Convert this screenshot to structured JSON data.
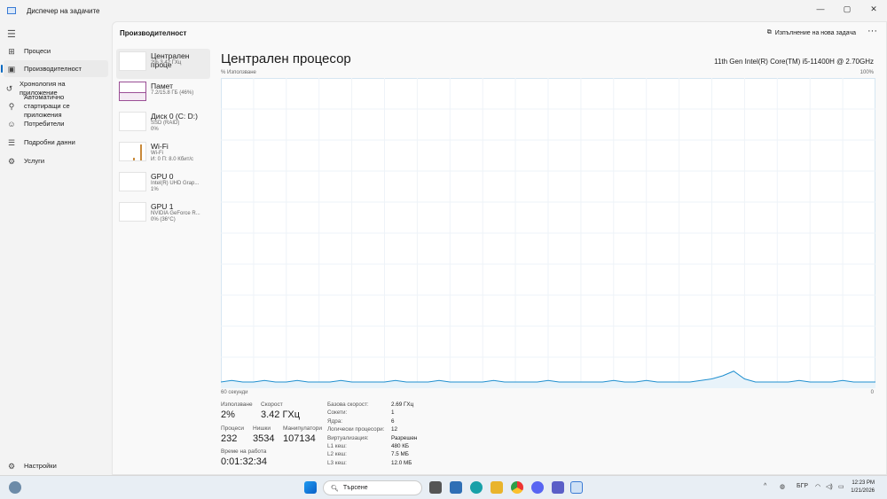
{
  "window": {
    "title": "Диспечер на задачите",
    "min": "—",
    "max": "▢",
    "close": "✕"
  },
  "nav": {
    "items": [
      {
        "label": "Процеси",
        "icon": "processes-icon",
        "glyph": "⊞"
      },
      {
        "label": "Производителност",
        "icon": "performance-icon",
        "glyph": "▣"
      },
      {
        "label": "Хронология на приложение",
        "icon": "history-icon",
        "glyph": "↺"
      },
      {
        "label": "Автоматично стартиращи се приложения",
        "icon": "startup-icon",
        "glyph": "⚲"
      },
      {
        "label": "Потребители",
        "icon": "users-icon",
        "glyph": "☺"
      },
      {
        "label": "Подробни данни",
        "icon": "details-icon",
        "glyph": "☰"
      },
      {
        "label": "Услуги",
        "icon": "services-icon",
        "glyph": "⚙"
      }
    ],
    "settings": "Настройки"
  },
  "header": {
    "title": "Производителност",
    "new_task": "Изпълнение на нова задача",
    "more": "···"
  },
  "devices": [
    {
      "name": "Централен проце",
      "s1": "2% 3.42 ГХц",
      "s2": ""
    },
    {
      "name": "Памет",
      "s1": "7.2/15.8 ГБ (46%)",
      "s2": ""
    },
    {
      "name": "Диск 0 (C: D:)",
      "s1": "SSD (RAID)",
      "s2": "0%"
    },
    {
      "name": "Wi-Fi",
      "s1": "Wi-Fi",
      "s2": "И: 0 П: 8.0 Кбит/с"
    },
    {
      "name": "GPU 0",
      "s1": "Intel(R) UHD Grap...",
      "s2": "1%"
    },
    {
      "name": "GPU 1",
      "s1": "NVIDIA GeForce R...",
      "s2": "0% (36°C)"
    }
  ],
  "cpu": {
    "title": "Централен процесор",
    "model": "11th Gen Intel(R) Core(TM) i5-11400H @ 2.70GHz",
    "usage_label": "Използване",
    "usage": "2%",
    "speed_label": "Скорост",
    "speed": "3.42 ГХц",
    "proc_label": "Процеси",
    "proc": "232",
    "threads_label": "Нишки",
    "threads": "3534",
    "handles_label": "Манипулатори",
    "handles": "107134",
    "uptime_label": "Време на работа",
    "uptime": "0:01:32:34",
    "specs": [
      [
        "Базова скорост:",
        "2.69 ГХц"
      ],
      [
        "Сокети:",
        "1"
      ],
      [
        "Ядра:",
        "6"
      ],
      [
        "Логически процесори:",
        "12"
      ],
      [
        "Виртуализация:",
        "Разрешен"
      ],
      [
        "L1 кеш:",
        "480 КБ"
      ],
      [
        "L2 кеш:",
        "7.5 МБ"
      ],
      [
        "L3 кеш:",
        "12.0 МБ"
      ]
    ]
  },
  "chart_data": {
    "type": "line",
    "ylabel": "% Използване",
    "ymax_label": "100%",
    "xlabel_left": "60 секунди",
    "xlabel_right": "0",
    "ylim": [
      0,
      100
    ],
    "xlim": [
      60,
      0
    ],
    "grid": true,
    "series": [
      {
        "name": "CPU",
        "color": "#1f8fcf",
        "values": [
          2,
          2.5,
          2,
          2,
          2.5,
          2,
          2,
          2.5,
          2,
          2,
          2,
          2.5,
          2,
          2,
          2,
          2,
          2.5,
          2,
          2,
          2,
          2.5,
          2,
          2,
          2,
          2,
          2.5,
          2,
          2,
          2,
          2,
          2.5,
          2,
          2,
          2,
          2,
          2,
          2.5,
          2,
          2,
          2.5,
          2,
          2,
          2,
          2,
          2.5,
          3,
          4,
          5.5,
          3,
          2,
          2,
          2,
          2,
          2.5,
          2,
          2,
          2,
          2.5,
          2,
          2,
          2
        ]
      }
    ]
  },
  "taskbar": {
    "search": "Търсене",
    "lang": "БГР",
    "time": "12:23 PM",
    "date": "1/21/2026"
  }
}
